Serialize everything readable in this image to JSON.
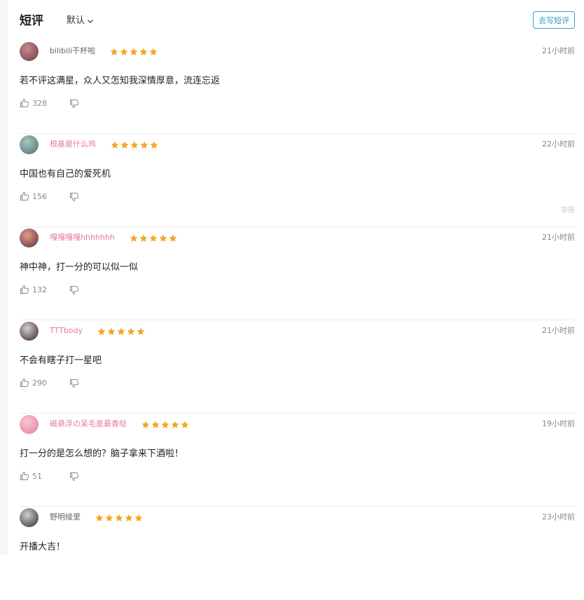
{
  "header": {
    "title": "短评",
    "sort_label": "默认",
    "write_button": "去写短评"
  },
  "colors": {
    "star": "#f5a623",
    "accent": "#2f9bc0",
    "pink_name": "#e8799b",
    "gray_name": "#666666"
  },
  "reviews": [
    {
      "user": "bilibili干杯啦",
      "name_color": "#666666",
      "rating": 5,
      "time": "21小时前",
      "content": "若不评这满星，众人又怎知我深情厚意，流连忘返",
      "likes": "328",
      "avatar_colors": [
        "#c88a8e",
        "#6b3b45"
      ]
    },
    {
      "user": "根基是什么鸡",
      "name_color": "#e8799b",
      "rating": 5,
      "time": "22小时前",
      "content": "中国也有自己的爱死机",
      "likes": "156",
      "report": "举报",
      "avatar_colors": [
        "#a9c8c0",
        "#4c6d75"
      ]
    },
    {
      "user": "嘎嘎嘎嘎hhhhhhh",
      "name_color": "#e8799b",
      "rating": 5,
      "time": "21小时前",
      "content": "神中神，打一分的可以似一似",
      "likes": "132",
      "avatar_colors": [
        "#e49a8e",
        "#5b2f35"
      ]
    },
    {
      "user": "TTTbody",
      "name_color": "#e8799b",
      "rating": 5,
      "time": "21小时前",
      "content": "不会有瞎子打一星吧",
      "likes": "290",
      "avatar_colors": [
        "#d0d0d0",
        "#3a1f22"
      ]
    },
    {
      "user": "磁悬浮の呆毛是最香哒",
      "name_color": "#e8799b",
      "rating": 5,
      "time": "19小时前",
      "content": "打一分的是怎么想的？脑子拿来下酒啦！",
      "likes": "51",
      "avatar_colors": [
        "#f7c8d4",
        "#e37f9c"
      ]
    },
    {
      "user": "野明绫里",
      "name_color": "#666666",
      "rating": 5,
      "time": "23小时前",
      "content": "开播大吉！",
      "likes": "",
      "avatar_colors": [
        "#cfcfcf",
        "#2a2a2a"
      ]
    }
  ]
}
